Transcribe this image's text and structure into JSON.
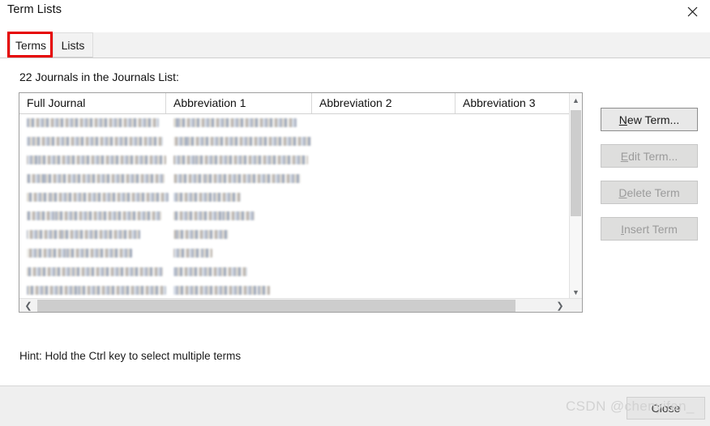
{
  "window": {
    "title": "Term Lists",
    "close_icon": "close-x-icon"
  },
  "tabs": [
    {
      "label": "Terms",
      "active": true
    },
    {
      "label": "Lists",
      "active": false
    }
  ],
  "annotation": {
    "type": "red-rectangle-highlight",
    "target": "Terms tab",
    "color": "#e60000"
  },
  "content": {
    "count_label": "22 Journals in the Journals List:",
    "hint": "Hint: Hold the Ctrl key to select multiple terms"
  },
  "list": {
    "columns": [
      "Full Journal",
      "Abbreviation 1",
      "Abbreviation 2",
      "Abbreviation 3"
    ],
    "rows_visible": 11,
    "rows_redacted": true,
    "rows": [
      {
        "full_journal_width": 163,
        "abbrev1_width": 152
      },
      {
        "full_journal_width": 168,
        "abbrev1_width": 170
      },
      {
        "full_journal_width": 172,
        "abbrev1_width": 166
      },
      {
        "full_journal_width": 170,
        "abbrev1_width": 157
      },
      {
        "full_journal_width": 175,
        "abbrev1_width": 83
      },
      {
        "full_journal_width": 166,
        "abbrev1_width": 100
      },
      {
        "full_journal_width": 140,
        "abbrev1_width": 68
      },
      {
        "full_journal_width": 130,
        "abbrev1_width": 48
      },
      {
        "full_journal_width": 168,
        "abbrev1_width": 91
      },
      {
        "full_journal_width": 172,
        "abbrev1_width": 119
      },
      {
        "full_journal_width": 176,
        "abbrev1_width": 150
      }
    ],
    "vscrollbar": {
      "up_icon": "chevron-up-icon",
      "down_icon": "chevron-down-icon"
    },
    "hscrollbar": {
      "left_icon": "chevron-left-icon",
      "right_icon": "chevron-right-icon"
    }
  },
  "buttons": {
    "new_term": {
      "label_key": "N",
      "label_rest": "ew Term...",
      "enabled": true
    },
    "edit_term": {
      "label_key": "E",
      "label_rest": "dit Term...",
      "enabled": false
    },
    "delete_term": {
      "label_key": "D",
      "label_rest": "elete Term",
      "enabled": false
    },
    "insert_term": {
      "label_key": "I",
      "label_rest": "nsert Term",
      "enabled": false
    }
  },
  "footer": {
    "close_label": "Close"
  },
  "watermark": {
    "text": "CSDN @chenyifan_"
  }
}
